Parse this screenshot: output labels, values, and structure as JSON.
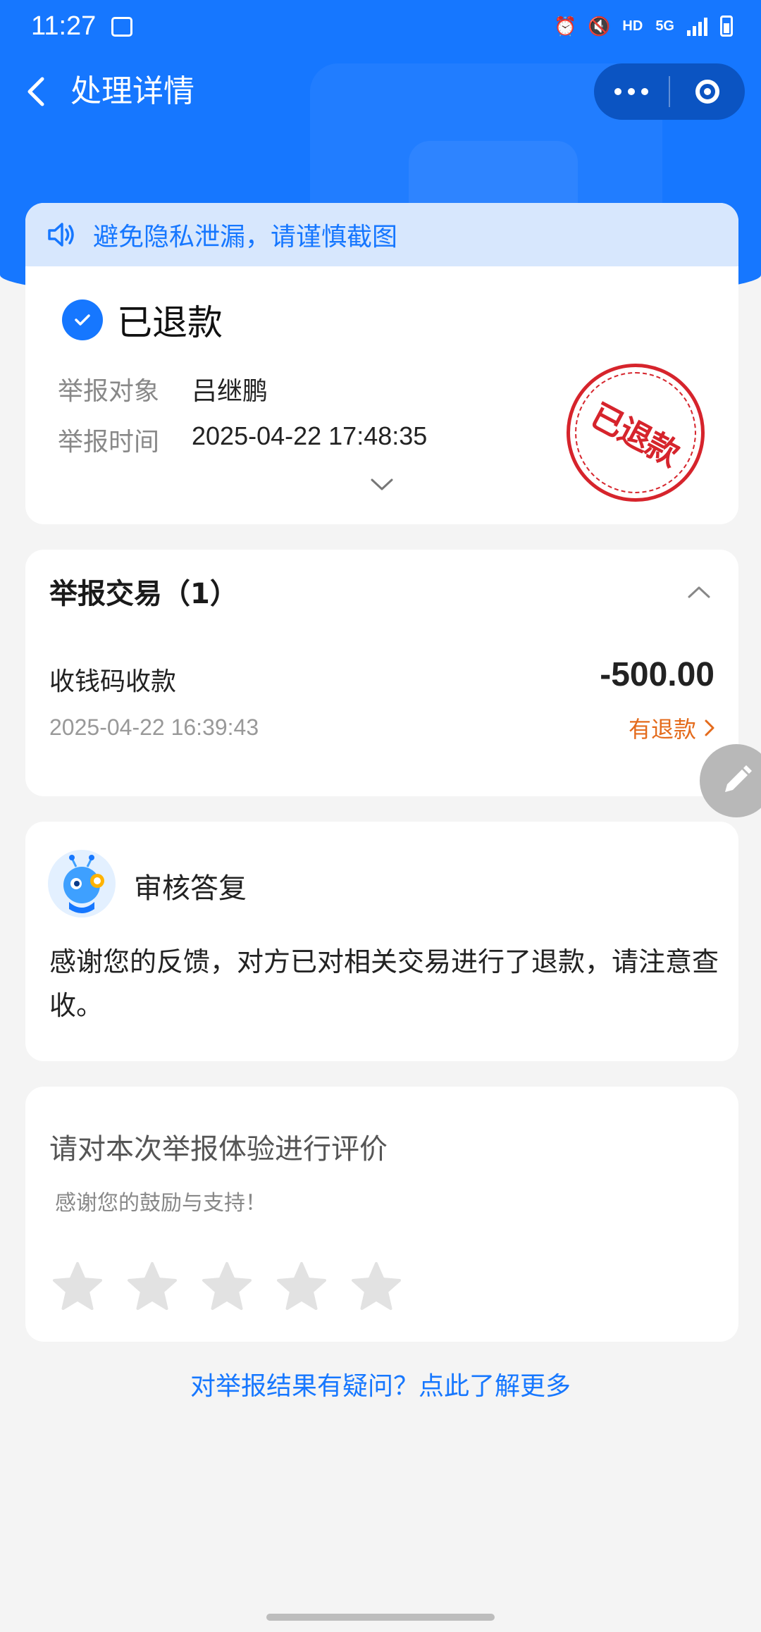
{
  "status_bar": {
    "time": "11:27",
    "hd": "HD",
    "network": "5G"
  },
  "nav": {
    "title": "处理详情"
  },
  "notice": {
    "text": "避免隐私泄漏，请谨慎截图"
  },
  "result": {
    "status": "已退款",
    "target_label": "举报对象",
    "target_value": "吕继鹏",
    "time_label": "举报时间",
    "time_value": "2025-04-22 17:48:35",
    "stamp": "已退款"
  },
  "transactions": {
    "title": "举报交易（1）",
    "items": [
      {
        "name": "收钱码收款",
        "amount": "-500.00",
        "time": "2025-04-22 16:39:43",
        "status": "有退款"
      }
    ]
  },
  "review": {
    "title": "审核答复",
    "body": "感谢您的反馈，对方已对相关交易进行了退款，请注意查收。"
  },
  "rating": {
    "title": "请对本次举报体验进行评价",
    "subtitle": "感谢您的鼓励与支持！",
    "stars": 0,
    "max_stars": 5
  },
  "footer": {
    "link": "对举报结果有疑问？点此了解更多"
  },
  "colors": {
    "primary": "#1677ff",
    "refund": "#e46b1c",
    "stamp": "#d6242c"
  }
}
